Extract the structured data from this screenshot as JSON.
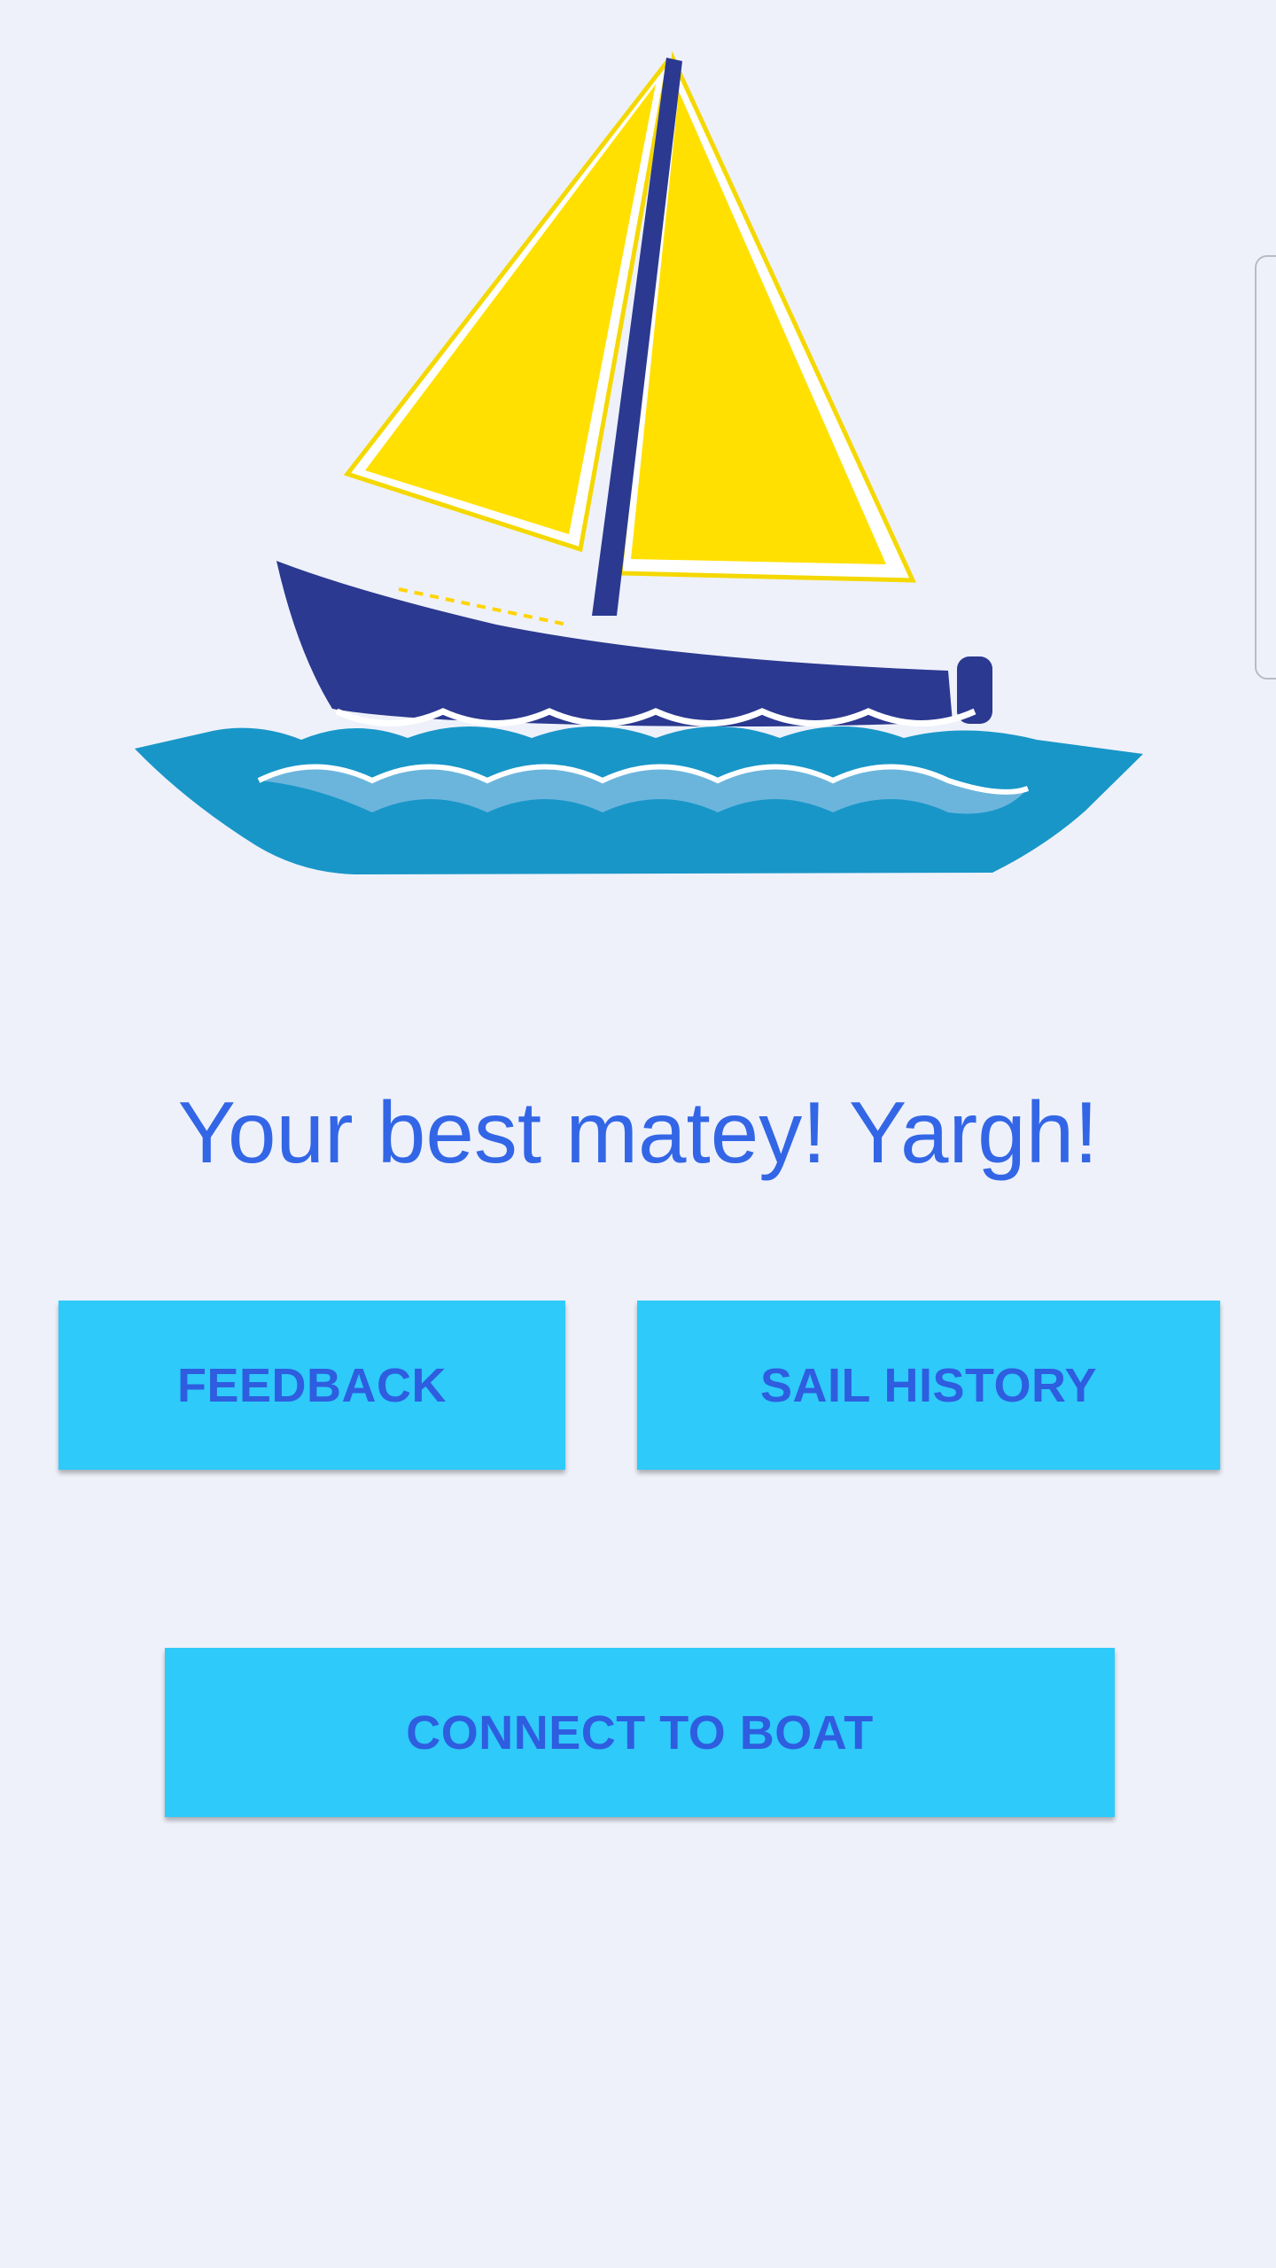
{
  "app": {
    "logo_icon": "sailboat-logo-icon",
    "tagline": "Your best matey! Yargh!"
  },
  "actions": {
    "feedback_label": "FEEDBACK",
    "sail_history_label": "SAIL HISTORY",
    "connect_label": "CONNECT TO BOAT"
  },
  "colors": {
    "background": "#eef1fa",
    "accent": "#2ecafa",
    "text": "#3366e6",
    "sail": "#ffe000",
    "hull": "#2b3990",
    "water": "#1896c8"
  }
}
